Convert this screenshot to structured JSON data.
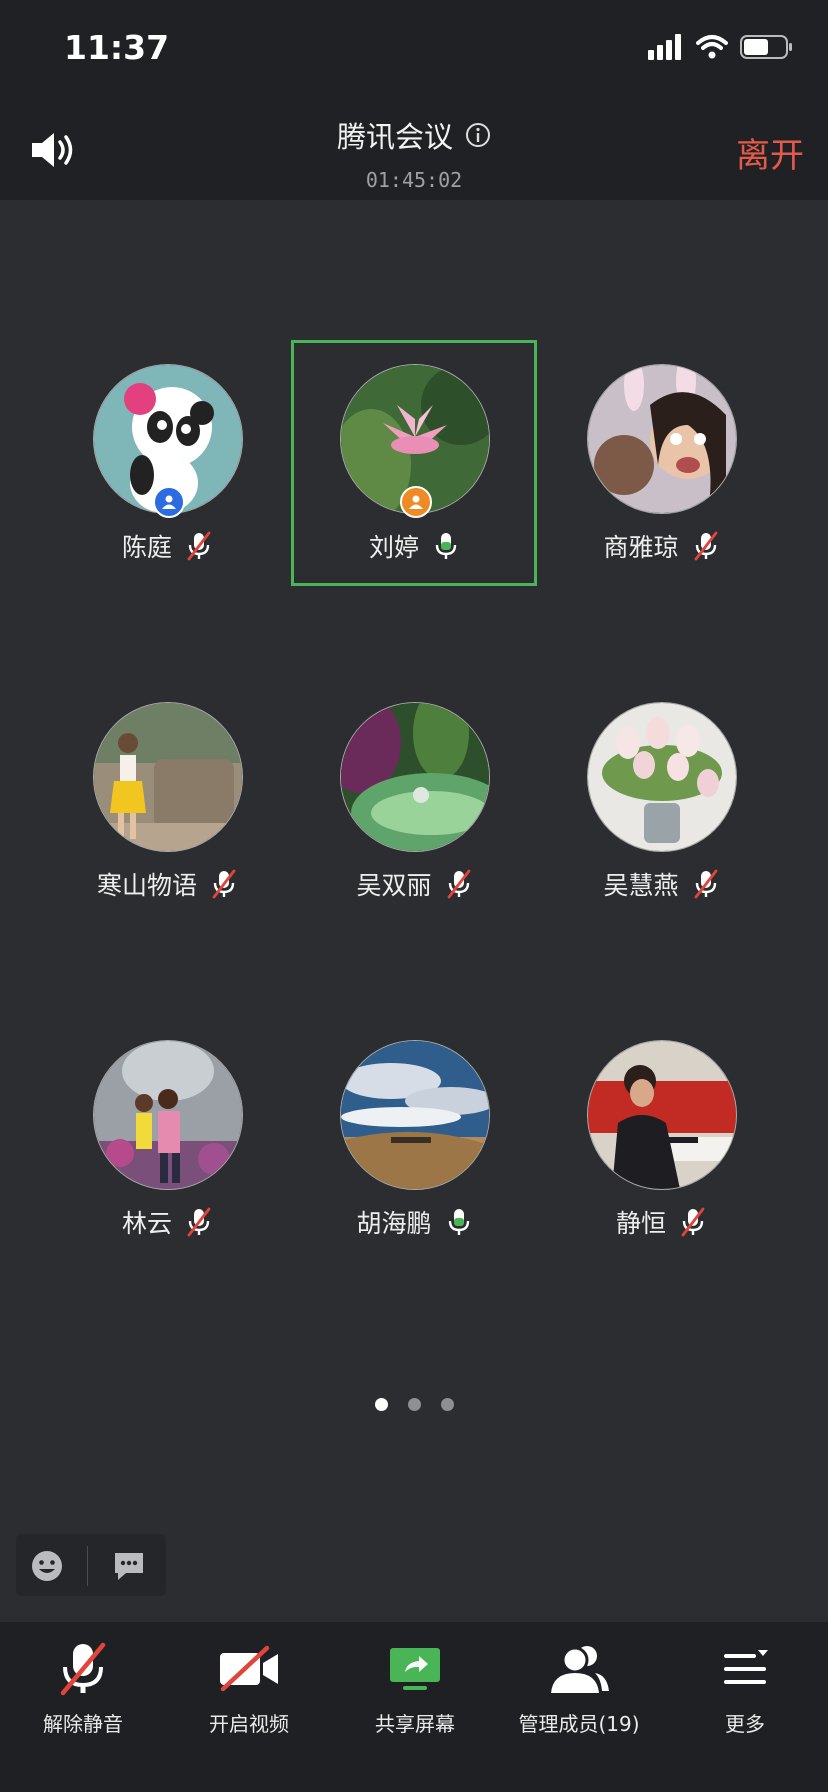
{
  "status": {
    "time": "11:37"
  },
  "header": {
    "title": "腾讯会议",
    "timer": "01:45:02",
    "leave": "离开"
  },
  "participants": [
    {
      "name": "陈庭",
      "mic": "muted",
      "badge": "host",
      "avatar": "panda"
    },
    {
      "name": "刘婷",
      "mic": "on",
      "badge": "cohost",
      "avatar": "lotus",
      "active": true
    },
    {
      "name": "商雅琼",
      "mic": "muted",
      "avatar": "selfie"
    },
    {
      "name": "寒山物语",
      "mic": "muted",
      "avatar": "park"
    },
    {
      "name": "吴双丽",
      "mic": "muted",
      "avatar": "leaf"
    },
    {
      "name": "吴慧燕",
      "mic": "muted",
      "avatar": "tulips"
    },
    {
      "name": "林云",
      "mic": "muted",
      "avatar": "garden"
    },
    {
      "name": "胡海鹏",
      "mic": "on",
      "avatar": "desert"
    },
    {
      "name": "静恒",
      "mic": "muted",
      "avatar": "calligraphy"
    }
  ],
  "pager": {
    "pages": 3,
    "current": 1
  },
  "toolbar": {
    "unmute": "解除静音",
    "video": "开启视频",
    "share": "共享屏幕",
    "members": "管理成员(19)",
    "more": "更多"
  },
  "colors": {
    "accent_green": "#4ab556",
    "leave_red": "#e35a4a",
    "host_blue": "#2d6be0",
    "cohost_orange": "#f08a24"
  }
}
